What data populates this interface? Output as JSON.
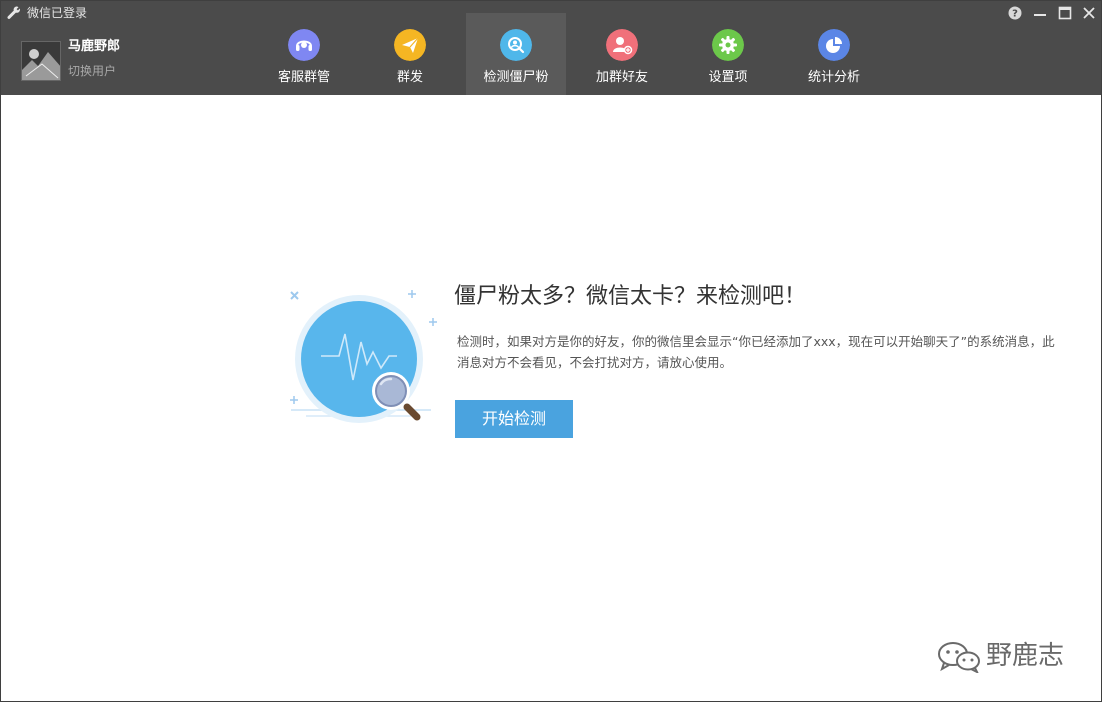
{
  "window": {
    "title": "微信已登录"
  },
  "user": {
    "name": "马鹿野郎",
    "switch_label": "切换用户"
  },
  "nav": {
    "items": [
      {
        "label": "客服群管",
        "icon": "headset-icon",
        "color": "#7f87f2"
      },
      {
        "label": "群发",
        "icon": "paper-plane-icon",
        "color": "#f5b623"
      },
      {
        "label": "检测僵尸粉",
        "icon": "detect-icon",
        "color": "#4fb7ea"
      },
      {
        "label": "加群好友",
        "icon": "add-friend-icon",
        "color": "#f0707a"
      },
      {
        "label": "设置项",
        "icon": "gear-icon",
        "color": "#6cc84a"
      },
      {
        "label": "统计分析",
        "icon": "pie-chart-icon",
        "color": "#5b86e6"
      }
    ],
    "active_index": 2
  },
  "main": {
    "headline": "僵尸粉太多？微信太卡？来检测吧！",
    "description": "检测时，如果对方是你的好友，你的微信里会显示“你已经添加了xxx，现在可以开始聊天了”的系统消息，此消息对方不会看见，不会打扰对方，请放心使用。",
    "start_button": "开始检测"
  },
  "watermark": {
    "text": "野鹿志"
  },
  "colors": {
    "header_bg": "#4b4b4b",
    "accent": "#4aa3df"
  }
}
